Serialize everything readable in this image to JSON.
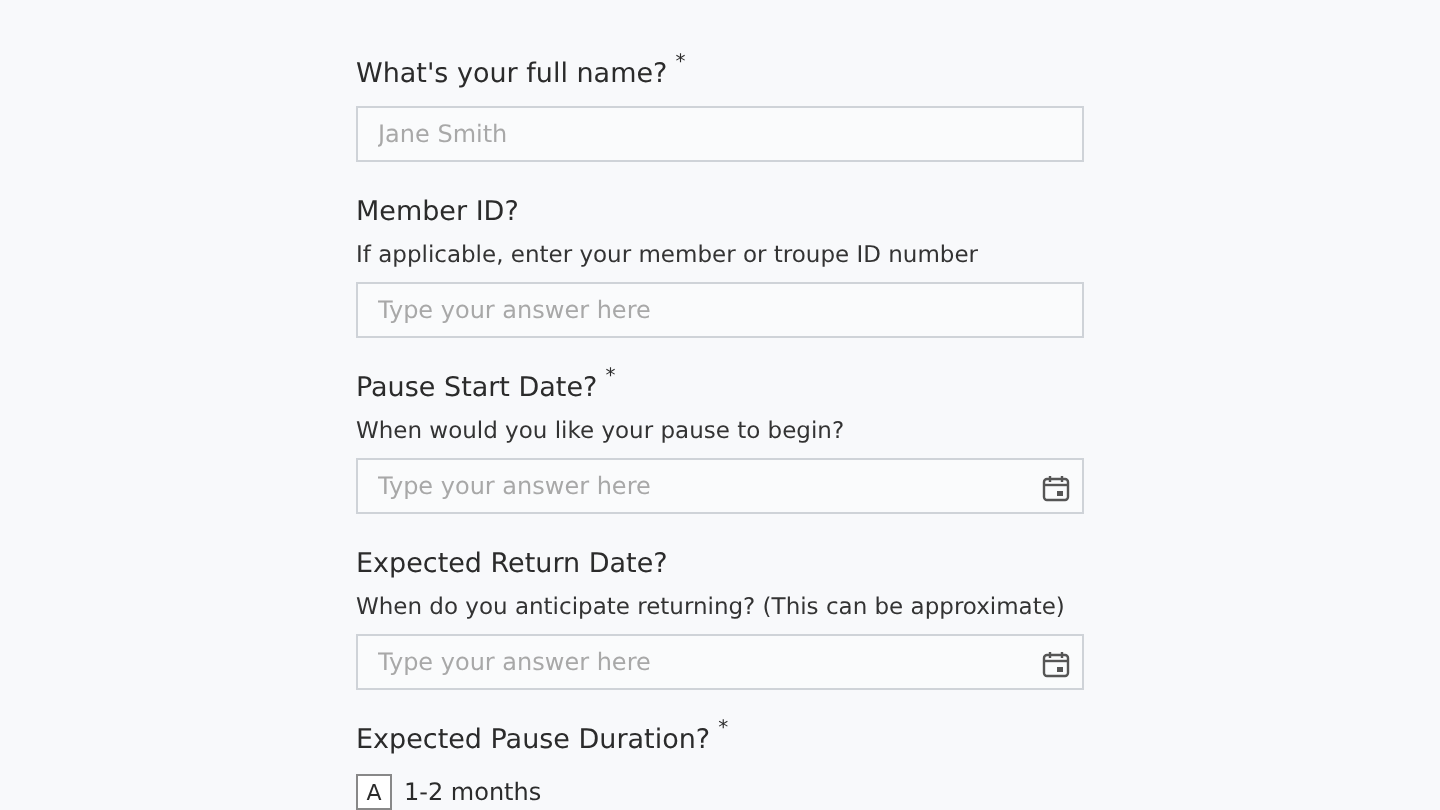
{
  "questions": [
    {
      "kind": "text",
      "label": "What's your full name?",
      "required_mark": "*",
      "placeholder": "Jane Smith"
    },
    {
      "kind": "text",
      "label": "Member ID?",
      "description": "If applicable, enter your member or troupe ID number",
      "placeholder": "Type your answer here"
    },
    {
      "kind": "date",
      "label": "Pause Start Date?",
      "required_mark": "*",
      "description": "When would you like your pause to begin?",
      "placeholder": "Type your answer here"
    },
    {
      "kind": "date",
      "label": "Expected Return Date?",
      "description": "When do you anticipate returning? (This can be approximate)",
      "placeholder": "Type your answer here"
    },
    {
      "kind": "choice",
      "label": "Expected Pause Duration?",
      "required_mark": "*",
      "options": [
        {
          "key": "A",
          "label": "1-2 months"
        }
      ]
    }
  ]
}
